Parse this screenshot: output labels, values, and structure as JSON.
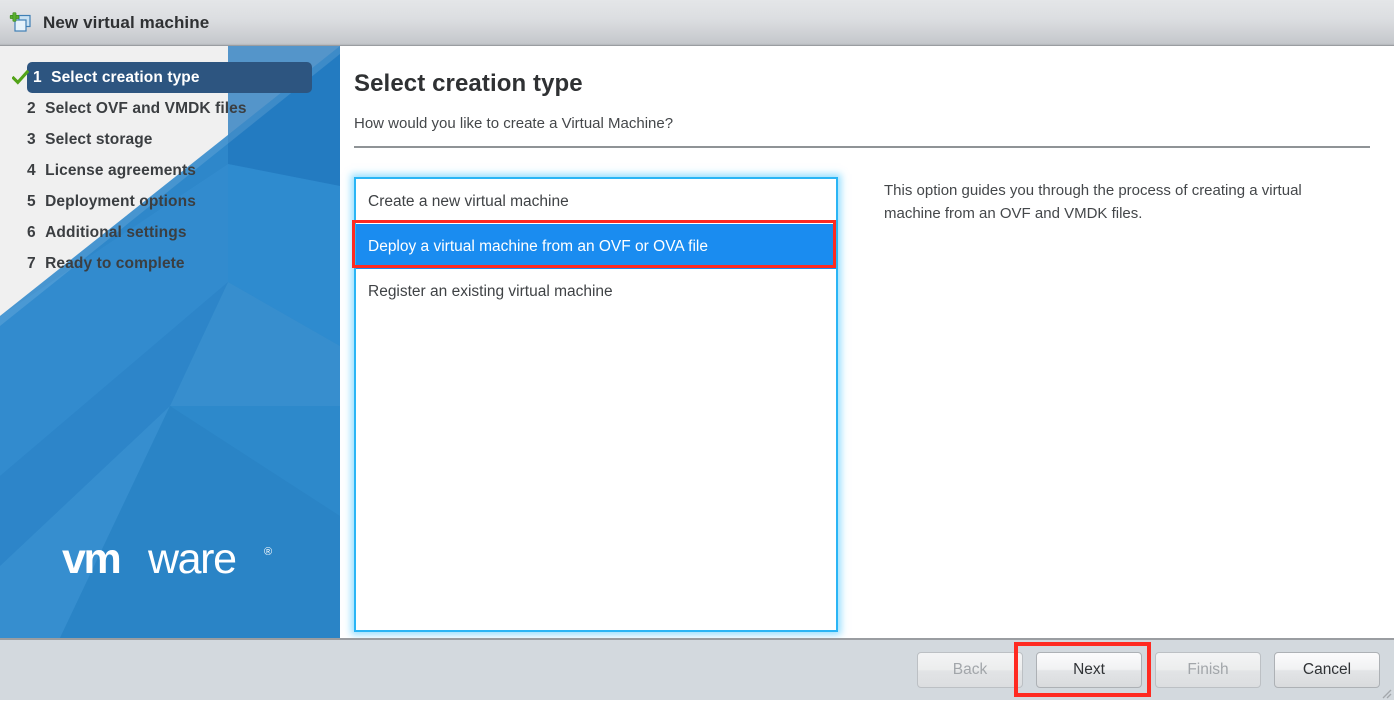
{
  "window": {
    "title": "New virtual machine",
    "icon": "new-virtual-machine-icon"
  },
  "sidebar": {
    "brand": "vmware",
    "brand_trademark": "®",
    "steps": [
      {
        "number": "1",
        "label": "Select creation type",
        "state": "active-completed"
      },
      {
        "number": "2",
        "label": "Select OVF and VMDK files",
        "state": "pending"
      },
      {
        "number": "3",
        "label": "Select storage",
        "state": "pending"
      },
      {
        "number": "4",
        "label": "License agreements",
        "state": "pending"
      },
      {
        "number": "5",
        "label": "Deployment options",
        "state": "pending"
      },
      {
        "number": "6",
        "label": "Additional settings",
        "state": "pending"
      },
      {
        "number": "7",
        "label": "Ready to complete",
        "state": "pending"
      }
    ]
  },
  "main": {
    "title": "Select creation type",
    "subtitle": "How would you like to create a Virtual Machine?",
    "options": [
      {
        "label": "Create a new virtual machine",
        "selected": false
      },
      {
        "label": "Deploy a virtual machine from an OVF or OVA file",
        "selected": true
      },
      {
        "label": "Register an existing virtual machine",
        "selected": false
      }
    ],
    "description": "This option guides you through the process of creating a virtual machine from an OVF and VMDK files."
  },
  "footer": {
    "back_label": "Back",
    "next_label": "Next",
    "finish_label": "Finish",
    "cancel_label": "Cancel"
  },
  "colors": {
    "accent_blue": "#1a8cf0",
    "focus_cyan": "#2ab5f5",
    "step_active": "#2d5580",
    "check_green": "#53a318",
    "annotation_red": "#ff2a21",
    "sidebar_blue": "#2e87ca",
    "titlebar_grey": "#dcdee1",
    "footer_grey": "#d3d9de"
  }
}
